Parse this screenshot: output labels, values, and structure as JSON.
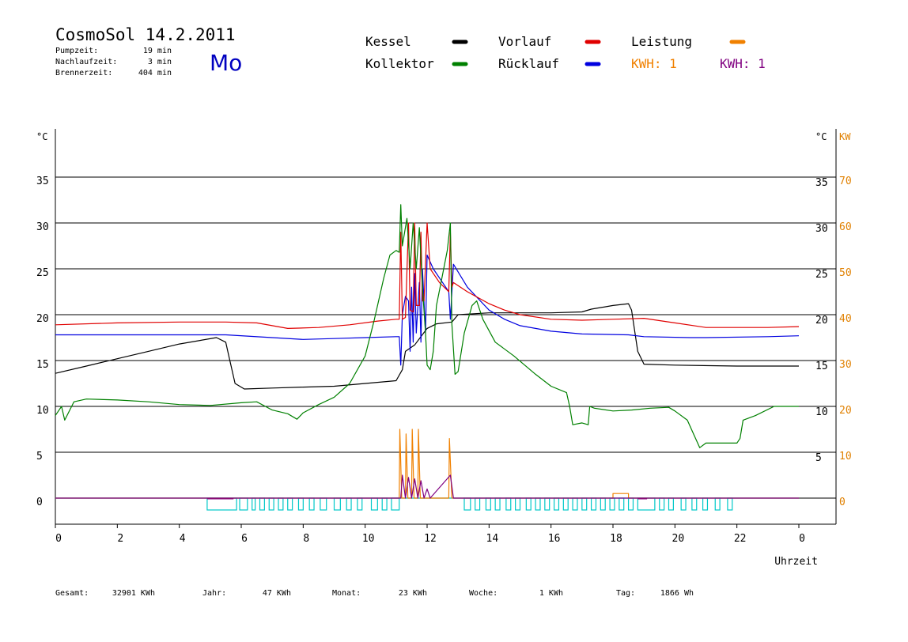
{
  "header": {
    "title": "CosmoSol 14.2.2011",
    "day": "Mo",
    "stats": [
      {
        "label": "Pumpzeit:",
        "value": "19 min"
      },
      {
        "label": "Nachlaufzeit:",
        "value": "3 min"
      },
      {
        "label": "Brennerzeit:",
        "value": "404 min"
      }
    ]
  },
  "legend": [
    {
      "label": "Kessel",
      "color": "#000000"
    },
    {
      "label": "Kollektor",
      "color": "#008000"
    },
    {
      "label": "Vorlauf",
      "color": "#e00000"
    },
    {
      "label": "Rücklauf",
      "color": "#0000e0"
    },
    {
      "label": "Leistung",
      "color": "#f08000"
    },
    {
      "label": "KWH: 1",
      "color": "#f08000",
      "text_colored": true
    },
    {
      "label": "KWH: 1",
      "color": "#800080",
      "text_colored": true
    }
  ],
  "footer": [
    {
      "label": "Gesamt:",
      "value": "32901 KWh"
    },
    {
      "label": "Jahr:",
      "value": "47 KWh"
    },
    {
      "label": "Monat:",
      "value": "23 KWh"
    },
    {
      "label": "Woche:",
      "value": "1 KWh"
    },
    {
      "label": "Tag:",
      "value": "1866 Wh"
    }
  ],
  "colors": {
    "kessel": "#000000",
    "kollektor": "#008000",
    "vorlauf": "#e00000",
    "ruecklauf": "#0000e0",
    "leistung": "#f08000",
    "kwh2": "#800080",
    "pump": "#00c8c8",
    "burner": "#800080",
    "grid": "#000000",
    "kw_axis": "#e08000",
    "day": "#0000c0"
  },
  "chart_data": {
    "type": "line",
    "xlabel": "Uhrzeit",
    "x_ticks": [
      "0",
      "2",
      "4",
      "6",
      "8",
      "10",
      "12",
      "14",
      "16",
      "18",
      "20",
      "22",
      "0"
    ],
    "xlim": [
      0,
      24
    ],
    "y_left": {
      "unit": "°C",
      "ticks": [
        "0",
        "5",
        "10",
        "15",
        "20",
        "25",
        "30",
        "35"
      ],
      "ylim": [
        -3,
        40
      ]
    },
    "y_right_temp": {
      "unit": "°C",
      "ticks": [
        "5",
        "10",
        "15",
        "20",
        "25",
        "30",
        "35"
      ]
    },
    "y_right_kw": {
      "unit": "KW",
      "ticks": [
        "0",
        "10",
        "20",
        "30",
        "40",
        "50",
        "60",
        "70"
      ],
      "ylim": [
        -6,
        80
      ]
    },
    "grid": true,
    "series": [
      {
        "name": "Kessel",
        "key": "kessel",
        "points": [
          [
            0,
            13.6
          ],
          [
            1,
            14.4
          ],
          [
            2,
            15.2
          ],
          [
            3,
            16.0
          ],
          [
            4,
            16.8
          ],
          [
            5.2,
            17.5
          ],
          [
            5.5,
            17.0
          ],
          [
            5.6,
            15.5
          ],
          [
            5.8,
            12.5
          ],
          [
            6.1,
            11.9
          ],
          [
            7,
            12.0
          ],
          [
            8,
            12.1
          ],
          [
            9,
            12.2
          ],
          [
            10,
            12.5
          ],
          [
            11,
            12.8
          ],
          [
            11.2,
            14.0
          ],
          [
            11.3,
            16.0
          ],
          [
            11.6,
            16.7
          ],
          [
            12,
            18.5
          ],
          [
            12.3,
            19.0
          ],
          [
            12.8,
            19.2
          ],
          [
            13,
            20.0
          ],
          [
            14,
            20.2
          ],
          [
            15,
            20.2
          ],
          [
            16,
            20.2
          ],
          [
            17,
            20.3
          ],
          [
            17.3,
            20.6
          ],
          [
            18,
            21.0
          ],
          [
            18.5,
            21.2
          ],
          [
            18.6,
            20.5
          ],
          [
            18.8,
            16.0
          ],
          [
            19,
            14.6
          ],
          [
            20,
            14.5
          ],
          [
            22,
            14.4
          ],
          [
            24,
            14.4
          ]
        ]
      },
      {
        "name": "Vorlauf",
        "key": "vorlauf",
        "points": [
          [
            0,
            18.9
          ],
          [
            2,
            19.1
          ],
          [
            4,
            19.2
          ],
          [
            5.5,
            19.2
          ],
          [
            6.5,
            19.1
          ],
          [
            7.5,
            18.5
          ],
          [
            8.5,
            18.6
          ],
          [
            9.5,
            18.9
          ],
          [
            10.4,
            19.3
          ],
          [
            11,
            19.5
          ],
          [
            11.1,
            19.5
          ],
          [
            11.15,
            29
          ],
          [
            11.2,
            19.5
          ],
          [
            11.3,
            19.7
          ],
          [
            11.4,
            30
          ],
          [
            11.45,
            20.5
          ],
          [
            11.55,
            20.3
          ],
          [
            11.6,
            30
          ],
          [
            11.65,
            21
          ],
          [
            11.75,
            21
          ],
          [
            11.8,
            29
          ],
          [
            11.85,
            21.5
          ],
          [
            11.9,
            21.5
          ],
          [
            12,
            30
          ],
          [
            12.1,
            25
          ],
          [
            12.4,
            23.5
          ],
          [
            12.7,
            22.5
          ],
          [
            12.75,
            29
          ],
          [
            12.8,
            23
          ],
          [
            12.85,
            23.5
          ],
          [
            13.3,
            22.5
          ],
          [
            14,
            21.2
          ],
          [
            14.5,
            20.5
          ],
          [
            15,
            20
          ],
          [
            16,
            19.5
          ],
          [
            17,
            19.4
          ],
          [
            18,
            19.5
          ],
          [
            19,
            19.6
          ],
          [
            20,
            19.1
          ],
          [
            21,
            18.6
          ],
          [
            23,
            18.6
          ],
          [
            24,
            18.7
          ]
        ]
      },
      {
        "name": "Rücklauf",
        "key": "ruecklauf",
        "points": [
          [
            0,
            17.8
          ],
          [
            2,
            17.8
          ],
          [
            4,
            17.8
          ],
          [
            5.5,
            17.8
          ],
          [
            7,
            17.5
          ],
          [
            8,
            17.3
          ],
          [
            9,
            17.4
          ],
          [
            10,
            17.5
          ],
          [
            11,
            17.6
          ],
          [
            11.1,
            17.6
          ],
          [
            11.15,
            14.5
          ],
          [
            11.2,
            20
          ],
          [
            11.3,
            22
          ],
          [
            11.4,
            21.5
          ],
          [
            11.45,
            16
          ],
          [
            11.5,
            23
          ],
          [
            11.55,
            17
          ],
          [
            11.6,
            24.5
          ],
          [
            11.65,
            18
          ],
          [
            11.75,
            23.5
          ],
          [
            11.8,
            17
          ],
          [
            11.85,
            25
          ],
          [
            11.95,
            18
          ],
          [
            12,
            26.5
          ],
          [
            12.2,
            25
          ],
          [
            12.5,
            23.5
          ],
          [
            12.7,
            22.5
          ],
          [
            12.75,
            19.5
          ],
          [
            12.85,
            25.5
          ],
          [
            13.3,
            23
          ],
          [
            14,
            20.5
          ],
          [
            14.5,
            19.5
          ],
          [
            15,
            18.8
          ],
          [
            16,
            18.2
          ],
          [
            17,
            17.9
          ],
          [
            18.5,
            17.8
          ],
          [
            19,
            17.6
          ],
          [
            20.5,
            17.5
          ],
          [
            21,
            17.5
          ],
          [
            23,
            17.6
          ],
          [
            24,
            17.7
          ]
        ]
      },
      {
        "name": "Kollektor",
        "key": "kollektor",
        "points": [
          [
            0,
            9.0
          ],
          [
            0.2,
            10.0
          ],
          [
            0.3,
            8.5
          ],
          [
            0.6,
            10.5
          ],
          [
            1,
            10.8
          ],
          [
            2,
            10.7
          ],
          [
            3,
            10.5
          ],
          [
            4,
            10.2
          ],
          [
            5,
            10.1
          ],
          [
            6,
            10.4
          ],
          [
            6.5,
            10.5
          ],
          [
            7,
            9.6
          ],
          [
            7.5,
            9.2
          ],
          [
            7.8,
            8.6
          ],
          [
            8,
            9.3
          ],
          [
            8.5,
            10.2
          ],
          [
            9,
            11.0
          ],
          [
            9.5,
            12.5
          ],
          [
            10,
            15.5
          ],
          [
            10.3,
            19.5
          ],
          [
            10.6,
            24.0
          ],
          [
            10.8,
            26.5
          ],
          [
            11,
            27.0
          ],
          [
            11.1,
            26.8
          ],
          [
            11.15,
            32
          ],
          [
            11.2,
            27.5
          ],
          [
            11.35,
            30.5
          ],
          [
            11.45,
            25
          ],
          [
            11.55,
            30
          ],
          [
            11.65,
            25
          ],
          [
            11.75,
            29.5
          ],
          [
            11.85,
            23
          ],
          [
            11.95,
            18
          ],
          [
            12.0,
            14.5
          ],
          [
            12.1,
            14.0
          ],
          [
            12.2,
            16
          ],
          [
            12.3,
            21
          ],
          [
            12.45,
            23.5
          ],
          [
            12.65,
            27
          ],
          [
            12.75,
            30
          ],
          [
            12.8,
            19
          ],
          [
            12.9,
            13.5
          ],
          [
            13.0,
            13.8
          ],
          [
            13.2,
            18
          ],
          [
            13.45,
            21.0
          ],
          [
            13.6,
            21.5
          ],
          [
            13.8,
            19.5
          ],
          [
            14.2,
            17.0
          ],
          [
            14.8,
            15.5
          ],
          [
            15.5,
            13.5
          ],
          [
            16,
            12.2
          ],
          [
            16.5,
            11.5
          ],
          [
            16.6,
            10
          ],
          [
            16.7,
            8.0
          ],
          [
            17,
            8.2
          ],
          [
            17.2,
            8.0
          ],
          [
            17.25,
            10
          ],
          [
            17.4,
            9.8
          ],
          [
            18,
            9.5
          ],
          [
            18.6,
            9.6
          ],
          [
            19.2,
            9.8
          ],
          [
            19.8,
            9.9
          ],
          [
            20,
            9.5
          ],
          [
            20.4,
            8.5
          ],
          [
            20.6,
            7.0
          ],
          [
            20.8,
            5.5
          ],
          [
            21,
            6.0
          ],
          [
            22,
            6.0
          ],
          [
            22.1,
            6.5
          ],
          [
            22.2,
            8.5
          ],
          [
            22.6,
            9.0
          ],
          [
            23.2,
            10.0
          ],
          [
            23.6,
            10.0
          ],
          [
            24,
            10.0
          ]
        ]
      },
      {
        "name": "Leistung",
        "key": "leistung",
        "axis": "kw",
        "points": [
          [
            0,
            0
          ],
          [
            11.1,
            0
          ],
          [
            11.12,
            15
          ],
          [
            11.18,
            0
          ],
          [
            11.3,
            0
          ],
          [
            11.32,
            14
          ],
          [
            11.38,
            0
          ],
          [
            11.5,
            0
          ],
          [
            11.52,
            15
          ],
          [
            11.58,
            0
          ],
          [
            11.7,
            0
          ],
          [
            11.72,
            15
          ],
          [
            11.78,
            0
          ],
          [
            12.7,
            0
          ],
          [
            12.72,
            13
          ],
          [
            12.8,
            0
          ],
          [
            18.0,
            0
          ],
          [
            18.0,
            1
          ],
          [
            18.5,
            1
          ],
          [
            18.5,
            0
          ],
          [
            24,
            0
          ]
        ]
      },
      {
        "name": "KWH",
        "key": "kwh2",
        "axis": "kw",
        "points": [
          [
            0,
            0
          ],
          [
            11.15,
            0
          ],
          [
            11.2,
            5
          ],
          [
            11.3,
            0
          ],
          [
            11.4,
            4.5
          ],
          [
            11.5,
            0
          ],
          [
            11.6,
            4.2
          ],
          [
            11.7,
            0
          ],
          [
            11.8,
            3.8
          ],
          [
            11.9,
            0
          ],
          [
            12.0,
            2
          ],
          [
            12.1,
            0
          ],
          [
            12.75,
            5
          ],
          [
            12.85,
            0
          ],
          [
            24,
            0
          ]
        ]
      }
    ],
    "burner_cycles": [
      [
        4.9,
        5.85
      ],
      [
        5.95,
        6.2
      ],
      [
        6.35,
        6.45
      ],
      [
        6.6,
        6.75
      ],
      [
        6.9,
        7.05
      ],
      [
        7.2,
        7.35
      ],
      [
        7.5,
        7.65
      ],
      [
        7.85,
        8.0
      ],
      [
        8.2,
        8.35
      ],
      [
        8.55,
        8.75
      ],
      [
        9.0,
        9.2
      ],
      [
        9.4,
        9.55
      ],
      [
        9.75,
        9.9
      ],
      [
        10.2,
        10.4
      ],
      [
        10.55,
        10.7
      ],
      [
        10.85,
        11.1
      ],
      [
        13.2,
        13.4
      ],
      [
        13.55,
        13.7
      ],
      [
        13.9,
        14.05
      ],
      [
        14.2,
        14.35
      ],
      [
        14.55,
        14.7
      ],
      [
        14.85,
        15.0
      ],
      [
        15.2,
        15.35
      ],
      [
        15.5,
        15.65
      ],
      [
        15.8,
        15.95
      ],
      [
        16.1,
        16.25
      ],
      [
        16.4,
        16.55
      ],
      [
        16.7,
        16.85
      ],
      [
        17.0,
        17.15
      ],
      [
        17.3,
        17.45
      ],
      [
        17.6,
        17.75
      ],
      [
        17.9,
        18.05
      ],
      [
        18.2,
        18.35
      ],
      [
        18.5,
        18.65
      ],
      [
        18.8,
        19.35
      ],
      [
        19.5,
        19.65
      ],
      [
        19.8,
        19.95
      ],
      [
        20.2,
        20.35
      ],
      [
        20.55,
        20.7
      ],
      [
        20.9,
        21.05
      ],
      [
        21.3,
        21.45
      ],
      [
        21.7,
        21.85
      ]
    ]
  }
}
